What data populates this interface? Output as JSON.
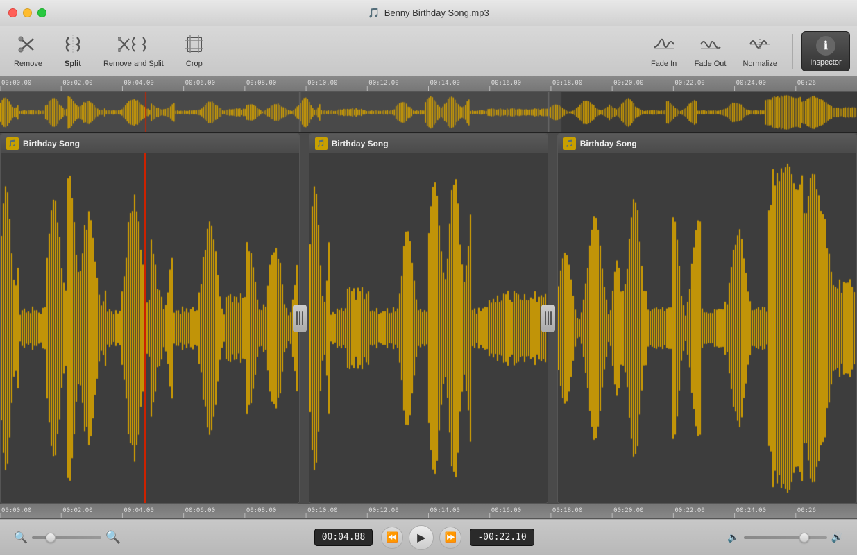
{
  "titlebar": {
    "title": "Benny Birthday Song.mp3"
  },
  "toolbar": {
    "buttons": [
      {
        "id": "remove",
        "icon": "✂",
        "label": "Remove",
        "active": false
      },
      {
        "id": "split",
        "icon": ")(",
        "label": "Split",
        "active": true
      },
      {
        "id": "remove-split",
        "icon": "✂)(",
        "label": "Remove and Split",
        "active": false
      },
      {
        "id": "crop",
        "icon": "⌧",
        "label": "Crop",
        "active": false
      }
    ],
    "right_buttons": [
      {
        "id": "fade-in",
        "icon": "~∧~",
        "label": "Fade In",
        "active": false
      },
      {
        "id": "fade-out",
        "icon": "~∨~",
        "label": "Fade Out",
        "active": false
      },
      {
        "id": "normalize",
        "icon": "↕~",
        "label": "Normalize",
        "active": false
      }
    ],
    "inspector_label": "Inspector"
  },
  "timeline": {
    "ruler_ticks": [
      "00:00.00",
      "00:02.00",
      "00:04.00",
      "00:06.00",
      "00:08.00",
      "00:10.00",
      "00:12.00",
      "00:14.00",
      "00:16.00",
      "00:18.00",
      "00:20.00",
      "00:22.00",
      "00:24.00",
      "00:26"
    ],
    "clips": [
      {
        "id": "clip1",
        "title": "Birthday Song",
        "left_pct": 0,
        "width_pct": 35
      },
      {
        "id": "clip2",
        "title": "Birthday Song",
        "left_pct": 36,
        "width_pct": 28
      },
      {
        "id": "clip3",
        "title": "Birthday Song",
        "left_pct": 65,
        "width_pct": 35
      }
    ],
    "playhead_pct": 17
  },
  "controls": {
    "current_time": "00:04.88",
    "remaining_time": "-00:22.10",
    "zoom_left_icon": "🔍",
    "zoom_right_icon": "🔍",
    "vol_low_icon": "🔈",
    "vol_high_icon": "🔊"
  }
}
